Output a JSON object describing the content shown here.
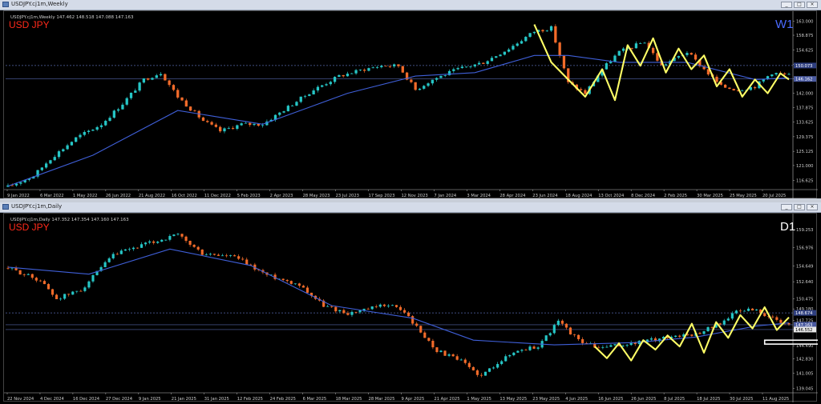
{
  "windows": [
    {
      "title": "USDJPY.cj1m,Weekly",
      "info_line": "USDJPY.cj1m,Weekly  147.462 148.518 147.088 147.163",
      "symbol_label": "USD JPY",
      "timeframe_label": "W1",
      "price_labels": [
        "163.000",
        "158.875",
        "154.625",
        "150.375",
        "146.162",
        "142.000",
        "137.875",
        "133.625",
        "129.375",
        "125.125",
        "121.000",
        "116.625"
      ],
      "price_tags": [
        "150.073",
        "146.162"
      ],
      "date_labels": [
        "9 Jan 2022",
        "6 Mar 2022",
        "1 May 2022",
        "26 Jun 2022",
        "21 Aug 2022",
        "16 Oct 2022",
        "11 Dec 2022",
        "5 Feb 2023",
        "2 Apr 2023",
        "28 May 2023",
        "23 Jul 2023",
        "17 Sep 2023",
        "12 Nov 2023",
        "7 Jan 2024",
        "3 Mar 2024",
        "28 Apr 2024",
        "23 Jun 2024",
        "18 Aug 2024",
        "13 Oct 2024",
        "8 Dec 2024",
        "2 Feb 2025",
        "30 Mar 2025",
        "25 May 2025",
        "20 Jul 2025"
      ]
    },
    {
      "title": "USDJPY.cj1m,Daily",
      "info_line": "USDJPY.cj1m,Daily  147.352 147.354 147.160 147.163",
      "symbol_label": "USD JPY",
      "timeframe_label": "D1",
      "price_labels": [
        "159.253",
        "156.976",
        "154.649",
        "152.640",
        "150.475",
        "149.180",
        "147.725",
        "146.552",
        "144.490",
        "142.830",
        "141.005",
        "139.045"
      ],
      "price_tags": [
        "148.674",
        "147.163",
        "146.552"
      ],
      "date_labels": [
        "22 Nov 2024",
        "4 Dec 2024",
        "16 Dec 2024",
        "27 Dec 2024",
        "9 Jan 2025",
        "21 Jan 2025",
        "31 Jan 2025",
        "12 Feb 2025",
        "24 Feb 2025",
        "6 Mar 2025",
        "18 Mar 2025",
        "28 Mar 2025",
        "9 Apr 2025",
        "21 Apr 2025",
        "1 May 2025",
        "13 May 2025",
        "23 May 2025",
        "4 Jun 2025",
        "16 Jun 2025",
        "26 Jun 2025",
        "8 Jul 2025",
        "18 Jul 2025",
        "30 Jul 2025",
        "11 Aug 2025"
      ]
    }
  ],
  "window_buttons": [
    "_",
    "□",
    "×"
  ],
  "colors": {
    "bull": "#26c6c6",
    "bear": "#f26b2a",
    "ma": "#3f5fd8",
    "zigzag": "#ffff66",
    "symbol": "#ff2a1a",
    "tf": "#4a6aff",
    "hline": "#3b4b8a",
    "box": "#ffffff"
  },
  "chart_data": [
    {
      "type": "candlestick",
      "title": "USDJPY.cj1m,Weekly",
      "ylim": [
        114.0,
        164.0
      ],
      "x_range": [
        "9 Jan 2022",
        "10 Aug 2025"
      ],
      "close_path": [
        [
          0,
          114.8
        ],
        [
          6,
          118
        ],
        [
          10,
          123
        ],
        [
          16,
          129
        ],
        [
          22,
          133
        ],
        [
          27,
          139
        ],
        [
          32,
          146
        ],
        [
          36,
          148
        ],
        [
          40,
          141
        ],
        [
          46,
          134
        ],
        [
          50,
          131
        ],
        [
          55,
          133
        ],
        [
          60,
          133
        ],
        [
          66,
          138
        ],
        [
          72,
          143
        ],
        [
          78,
          147
        ],
        [
          84,
          149
        ],
        [
          88,
          150
        ],
        [
          92,
          150
        ],
        [
          96,
          143
        ],
        [
          100,
          146
        ],
        [
          106,
          149
        ],
        [
          112,
          151
        ],
        [
          118,
          155
        ],
        [
          124,
          160
        ],
        [
          128,
          161
        ],
        [
          132,
          145
        ],
        [
          136,
          142
        ],
        [
          140,
          149
        ],
        [
          144,
          154
        ],
        [
          150,
          157
        ],
        [
          154,
          150
        ],
        [
          160,
          154
        ],
        [
          164,
          149
        ],
        [
          168,
          144
        ],
        [
          172,
          143
        ],
        [
          176,
          144
        ],
        [
          180,
          148
        ],
        [
          184,
          147.2
        ]
      ],
      "moving_average": [
        [
          0,
          115
        ],
        [
          20,
          124
        ],
        [
          40,
          137
        ],
        [
          50,
          135
        ],
        [
          60,
          133
        ],
        [
          80,
          142
        ],
        [
          96,
          147
        ],
        [
          110,
          148
        ],
        [
          124,
          153
        ],
        [
          132,
          153
        ],
        [
          144,
          151
        ],
        [
          160,
          151
        ],
        [
          176,
          146
        ],
        [
          184,
          146.5
        ]
      ],
      "zigzag": [
        [
          124,
          162
        ],
        [
          128,
          151
        ],
        [
          132,
          146
        ],
        [
          136,
          141
        ],
        [
          140,
          149
        ],
        [
          143,
          140
        ],
        [
          146,
          156
        ],
        [
          149,
          150
        ],
        [
          152,
          158
        ],
        [
          155,
          148
        ],
        [
          158,
          155
        ],
        [
          161,
          149
        ],
        [
          164,
          153
        ],
        [
          167,
          144
        ],
        [
          170,
          149
        ],
        [
          173,
          141
        ],
        [
          176,
          146
        ],
        [
          179,
          142
        ],
        [
          182,
          147.8
        ],
        [
          184,
          146
        ]
      ],
      "horizontal_lines": [
        150.073,
        146.162
      ],
      "candle_count": 185
    },
    {
      "type": "candlestick",
      "title": "USDJPY.cj1m,Daily",
      "ylim": [
        138.5,
        160.5
      ],
      "x_range": [
        "18 Nov 2024",
        "15 Aug 2025"
      ],
      "close_path": [
        [
          0,
          154.4
        ],
        [
          8,
          152.8
        ],
        [
          12,
          150.5
        ],
        [
          18,
          151.6
        ],
        [
          26,
          156.0
        ],
        [
          32,
          157.1
        ],
        [
          42,
          158.6
        ],
        [
          48,
          156.2
        ],
        [
          56,
          155.8
        ],
        [
          64,
          153.5
        ],
        [
          72,
          152.3
        ],
        [
          78,
          149.6
        ],
        [
          84,
          148.6
        ],
        [
          88,
          149.0
        ],
        [
          94,
          149.8
        ],
        [
          98,
          148.8
        ],
        [
          102,
          146.2
        ],
        [
          106,
          143.9
        ],
        [
          112,
          142.5
        ],
        [
          117,
          140.6
        ],
        [
          121,
          142.4
        ],
        [
          126,
          143.9
        ],
        [
          131,
          144.4
        ],
        [
          136,
          147.6
        ],
        [
          141,
          145.2
        ],
        [
          146,
          144.2
        ],
        [
          152,
          144.6
        ],
        [
          158,
          145.1
        ],
        [
          164,
          145.7
        ],
        [
          170,
          146.0
        ],
        [
          176,
          147.4
        ],
        [
          180,
          148.8
        ],
        [
          184,
          149.2
        ],
        [
          188,
          148.2
        ],
        [
          191,
          147.3
        ],
        [
          193,
          147.163
        ]
      ],
      "moving_average": [
        [
          0,
          154.5
        ],
        [
          20,
          153.6
        ],
        [
          40,
          156.8
        ],
        [
          60,
          154.7
        ],
        [
          80,
          149.6
        ],
        [
          100,
          148.0
        ],
        [
          115,
          145.2
        ],
        [
          135,
          144.6
        ],
        [
          155,
          144.9
        ],
        [
          170,
          145.6
        ],
        [
          185,
          147.0
        ],
        [
          193,
          147.4
        ]
      ],
      "zigzag": [
        [
          145,
          144.4
        ],
        [
          148,
          142.9
        ],
        [
          151,
          144.8
        ],
        [
          154,
          142.6
        ],
        [
          157,
          145.2
        ],
        [
          160,
          144.0
        ],
        [
          163,
          145.8
        ],
        [
          166,
          144.4
        ],
        [
          169,
          147.3
        ],
        [
          172,
          143.6
        ],
        [
          175,
          147.5
        ],
        [
          178,
          145.5
        ],
        [
          181,
          148.4
        ],
        [
          184,
          146.7
        ],
        [
          187,
          149.4
        ],
        [
          190,
          146.5
        ],
        [
          193,
          148.1
        ]
      ],
      "horizontal_lines": [
        148.674,
        147.163,
        146.552
      ],
      "candle_count": 194
    }
  ]
}
